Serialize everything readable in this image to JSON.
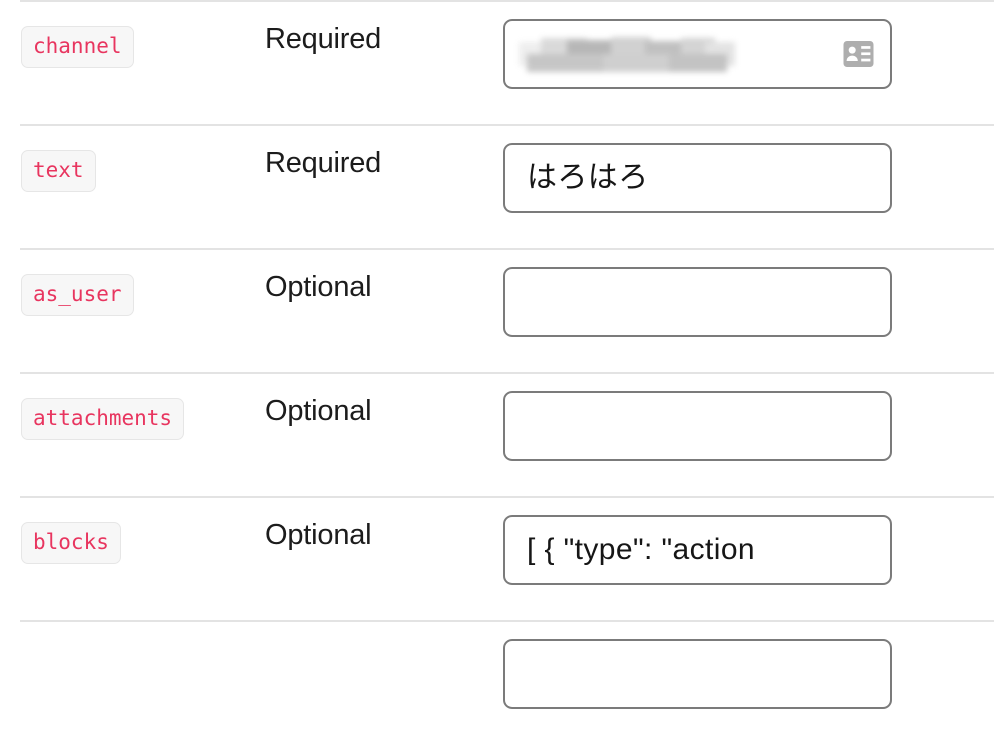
{
  "colors": {
    "badge_text": "#e8355f",
    "badge_bg": "#f7f7f7",
    "badge_border": "#e6e6e6",
    "divider": "#e3e3e3",
    "input_border": "#7b7b7b",
    "text": "#1c1c1c",
    "icon_gray": "#aeaeae"
  },
  "parameters": [
    {
      "name": "channel",
      "requirement": "Required",
      "value": "",
      "placeholder": "",
      "redacted": true,
      "icon": "contact-card-icon"
    },
    {
      "name": "text",
      "requirement": "Required",
      "value": "はろはろ",
      "placeholder": "",
      "redacted": false,
      "icon": ""
    },
    {
      "name": "as_user",
      "requirement": "Optional",
      "value": "",
      "placeholder": "",
      "redacted": false,
      "icon": ""
    },
    {
      "name": "attachments",
      "requirement": "Optional",
      "value": "",
      "placeholder": "",
      "redacted": false,
      "icon": ""
    },
    {
      "name": "blocks",
      "requirement": "Optional",
      "value": "[    {        \"type\": \"action",
      "placeholder": "",
      "redacted": false,
      "icon": ""
    },
    {
      "name": "",
      "requirement": "",
      "value": "",
      "placeholder": "",
      "redacted": false,
      "icon": ""
    }
  ]
}
